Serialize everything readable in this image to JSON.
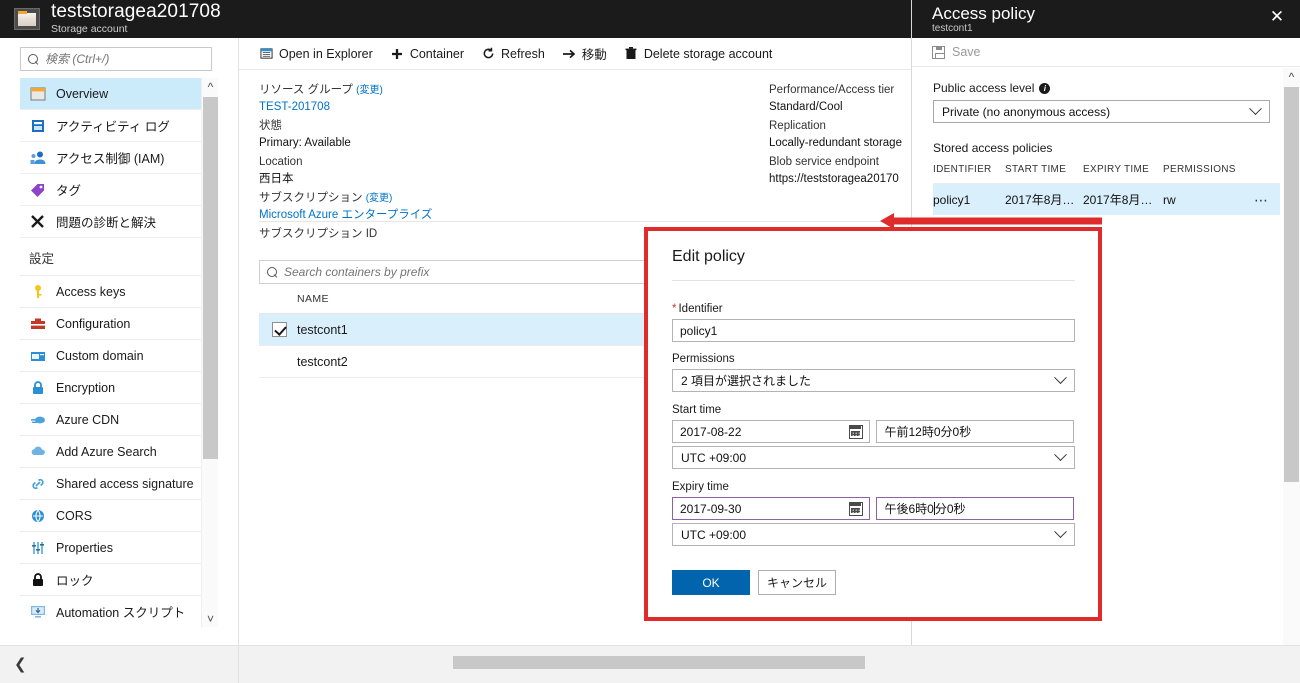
{
  "header": {
    "title": "teststoragea201708",
    "subtitle": "Storage account",
    "icon": "storage-account-icon"
  },
  "sidebar": {
    "search": {
      "placeholder": "検索 (Ctrl+/)",
      "value": "",
      "icon": "search-icon"
    },
    "scroll": {
      "up_icon": "chevron-up-icon",
      "down_icon": "chevron-down-icon"
    },
    "collapse_icon": "chevron-left-icon",
    "items": [
      {
        "label": "Overview",
        "icon": "overview-icon",
        "selected": true
      },
      {
        "label": "アクティビティ ログ",
        "icon": "activity-log-icon",
        "selected": false
      },
      {
        "label": "アクセス制御 (IAM)",
        "icon": "access-control-icon",
        "selected": false
      },
      {
        "label": "タグ",
        "icon": "tag-icon",
        "selected": false
      },
      {
        "label": "問題の診断と解決",
        "icon": "diagnose-icon",
        "selected": false
      }
    ],
    "section_label": "設定",
    "settings_items": [
      {
        "label": "Access keys",
        "icon": "key-icon"
      },
      {
        "label": "Configuration",
        "icon": "configuration-icon"
      },
      {
        "label": "Custom domain",
        "icon": "custom-domain-icon"
      },
      {
        "label": "Encryption",
        "icon": "lock-blue-icon"
      },
      {
        "label": "Azure CDN",
        "icon": "cdn-icon"
      },
      {
        "label": "Add Azure Search",
        "icon": "search-cloud-icon"
      },
      {
        "label": "Shared access signature",
        "icon": "link-icon"
      },
      {
        "label": "CORS",
        "icon": "cors-icon"
      },
      {
        "label": "Properties",
        "icon": "properties-icon"
      },
      {
        "label": "ロック",
        "icon": "lock-black-icon"
      },
      {
        "label": "Automation スクリプト",
        "icon": "automation-script-icon"
      }
    ]
  },
  "blade": {
    "commands": [
      {
        "label": "Open in Explorer",
        "icon": "open-in-explorer-icon"
      },
      {
        "label": "Container",
        "icon": "plus-icon"
      },
      {
        "label": "Refresh",
        "icon": "refresh-icon"
      },
      {
        "label": "移動",
        "icon": "move-arrow-icon"
      },
      {
        "label": "Delete storage account",
        "icon": "trash-icon"
      }
    ],
    "essentials_left": [
      {
        "label": "リソース グループ",
        "change": "(変更)",
        "value": "TEST-201708",
        "link": true
      },
      {
        "label": "状態",
        "change": "",
        "value": "Primary: Available",
        "link": false
      },
      {
        "label": "Location",
        "change": "",
        "value": "西日本",
        "link": false
      },
      {
        "label": "サブスクリプション",
        "change": "(変更)",
        "value": "Microsoft Azure エンタープライズ",
        "link": true
      },
      {
        "label": "サブスクリプション ID",
        "change": "",
        "value": "",
        "link": false
      }
    ],
    "essentials_right": [
      {
        "label": "Performance/Access tier",
        "value": "Standard/Cool"
      },
      {
        "label": "Replication",
        "value": "Locally-redundant storage"
      },
      {
        "label": "Blob service endpoint",
        "value": "https://teststoragea20170"
      }
    ],
    "container_search": {
      "placeholder": "Search containers by prefix",
      "value": "",
      "icon": "search-icon"
    },
    "table": {
      "columns": [
        "NAME"
      ],
      "rows": [
        {
          "name": "testcont1",
          "checked": true
        },
        {
          "name": "testcont2",
          "checked": false
        }
      ]
    }
  },
  "access_policy": {
    "title": "Access policy",
    "subtitle": "testcont1",
    "close_icon": "close-icon",
    "save_label": "Save",
    "save_icon": "save-icon",
    "public_access_label": "Public access level",
    "info_icon": "info-icon",
    "public_access_value": "Private (no anonymous access)",
    "stored_policies_label": "Stored access policies",
    "columns": [
      "IDENTIFIER",
      "START TIME",
      "EXPIRY TIME",
      "PERMISSIONS"
    ],
    "rows": [
      {
        "identifier": "policy1",
        "start_time": "2017年8月…",
        "expiry_time": "2017年8月…",
        "permissions": "rw",
        "menu_icon": "ellipsis-icon"
      }
    ],
    "scroll": {
      "up_icon": "chevron-up-icon",
      "down_icon": "chevron-down-icon"
    }
  },
  "edit_policy": {
    "title": "Edit policy",
    "identifier_label": "Identifier",
    "identifier_required": "*",
    "identifier_value": "policy1",
    "permissions_label": "Permissions",
    "permissions_value": "2 項目が選択されました",
    "start_time_label": "Start time",
    "start_date_value": "2017-08-22",
    "start_time_value": "午前12時0分0秒",
    "start_tz_value": "UTC +09:00",
    "expiry_time_label": "Expiry time",
    "expiry_date_value": "2017-09-30",
    "expiry_time_value_pre": "午後6時0",
    "expiry_time_value_post": "分0秒",
    "expiry_tz_value": "UTC +09:00",
    "ok_label": "OK",
    "cancel_label": "キャンセル",
    "calendar_icon": "calendar-icon",
    "chevron_icon": "chevron-down-icon",
    "accent_color": "#0264ac",
    "highlight_border_color": "#8d60a8",
    "annotation_color": "#e02b2b"
  },
  "bottom": {
    "scrollbar": "horizontal-scrollbar"
  }
}
